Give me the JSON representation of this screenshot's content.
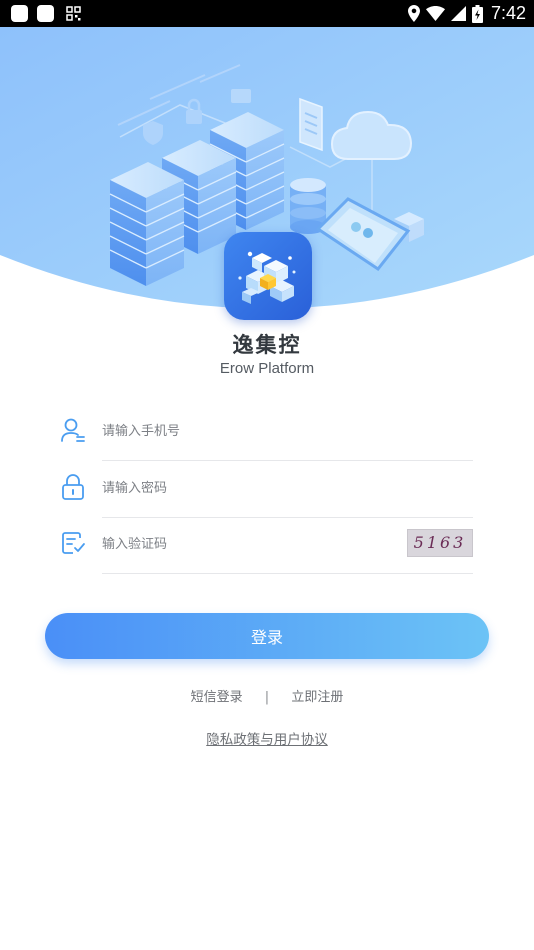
{
  "status_bar": {
    "time": "7:42",
    "icons": [
      "app-notification-icon",
      "app-notification-icon",
      "grid-icon",
      "location-icon",
      "wifi-icon",
      "signal-icon",
      "battery-icon"
    ]
  },
  "brand": {
    "name": "逸集控",
    "subtitle": "Erow Platform"
  },
  "form": {
    "phone": {
      "placeholder": "请输入手机号",
      "value": "",
      "icon": "user-icon"
    },
    "password": {
      "placeholder": "请输入密码",
      "value": "",
      "icon": "lock-icon"
    },
    "captcha": {
      "placeholder": "输入验证码",
      "value": "",
      "icon": "verify-icon",
      "code": "5163"
    }
  },
  "login_button": "登录",
  "links": {
    "sms_login": "短信登录",
    "separator": "|",
    "register": "立即注册"
  },
  "privacy": "隐私政策与用户协议",
  "colors": {
    "accent": "#4a8ff7",
    "accent_light": "#6cc3f6",
    "icon": "#4a9df0"
  }
}
